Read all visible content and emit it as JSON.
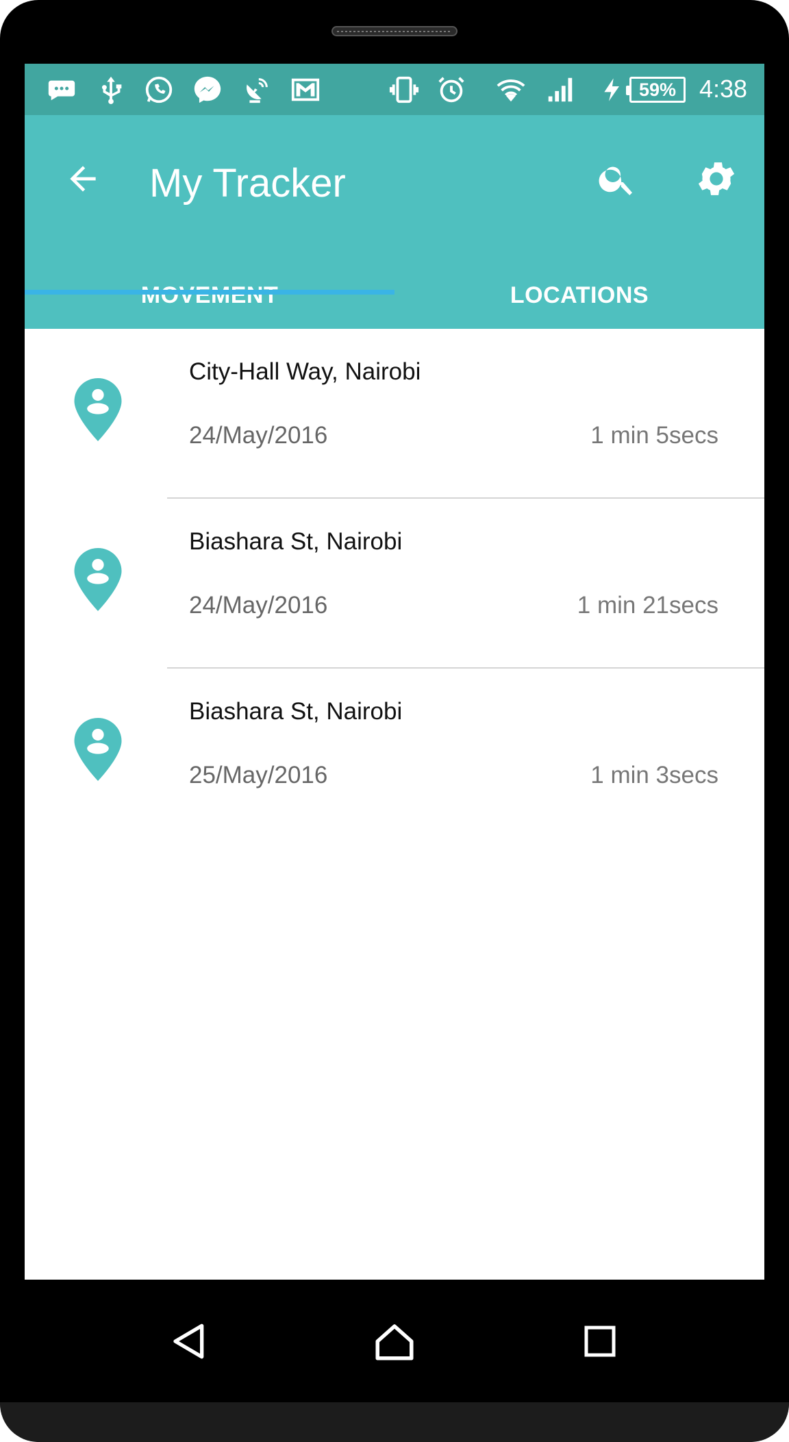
{
  "status_bar": {
    "battery_percent": "59%",
    "time": "4:38",
    "icons": [
      "message-icon",
      "usb-icon",
      "whatsapp-icon",
      "messenger-icon",
      "satellite-icon",
      "gmail-icon",
      "vibrate-icon",
      "alarm-icon",
      "wifi-icon",
      "signal-icon",
      "charging-icon",
      "battery-icon"
    ]
  },
  "app_bar": {
    "title": "My Tracker",
    "background_color": "#4fc0bf",
    "status_bar_color": "#41a6a0",
    "accent_color": "#3ab4e6"
  },
  "tabs": [
    {
      "label": "MOVEMENT",
      "selected": true
    },
    {
      "label": "LOCATIONS",
      "selected": false
    }
  ],
  "movements": [
    {
      "location": "City-Hall Way, Nairobi",
      "date": "24/May/2016",
      "duration": "1 min 5secs"
    },
    {
      "location": "Biashara St, Nairobi",
      "date": "24/May/2016",
      "duration": "1 min 21secs"
    },
    {
      "location": "Biashara St, Nairobi",
      "date": "25/May/2016",
      "duration": "1 min 3secs"
    }
  ],
  "nav_bar": {
    "icons": [
      "back-nav-icon",
      "home-nav-icon",
      "recents-nav-icon"
    ]
  }
}
